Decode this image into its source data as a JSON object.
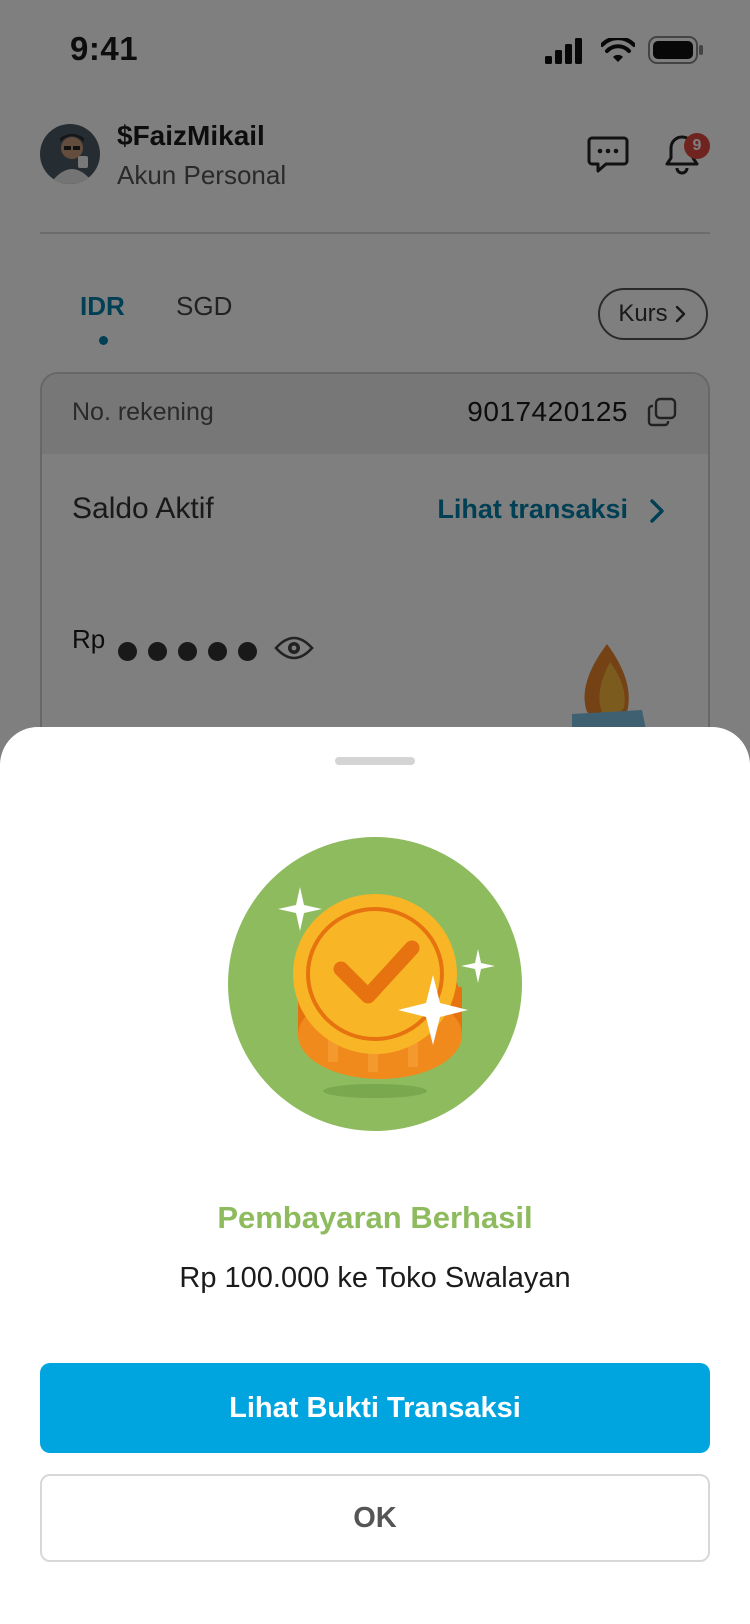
{
  "status_bar": {
    "time": "9:41"
  },
  "header": {
    "username": "$FaizMikail",
    "account_type": "Akun Personal",
    "notification_count": "9"
  },
  "tabs": [
    {
      "label": "IDR",
      "active": true
    },
    {
      "label": "SGD",
      "active": false
    }
  ],
  "kurs_button": {
    "label": "Kurs"
  },
  "account": {
    "number_label": "No. rekening",
    "number": "9017420125",
    "balance_label": "Saldo Aktif",
    "transactions_link": "Lihat transaksi",
    "currency_prefix": "Rp"
  },
  "sheet": {
    "title": "Pembayaran Berhasil",
    "description": "Rp 100.000 ke Toko Swalayan",
    "primary_button": "Lihat Bukti Transaksi",
    "secondary_button": "OK"
  },
  "colors": {
    "accent": "#007fa8",
    "primary_button": "#00a5df",
    "success": "#8dbb5e",
    "badge": "#e0493f"
  }
}
